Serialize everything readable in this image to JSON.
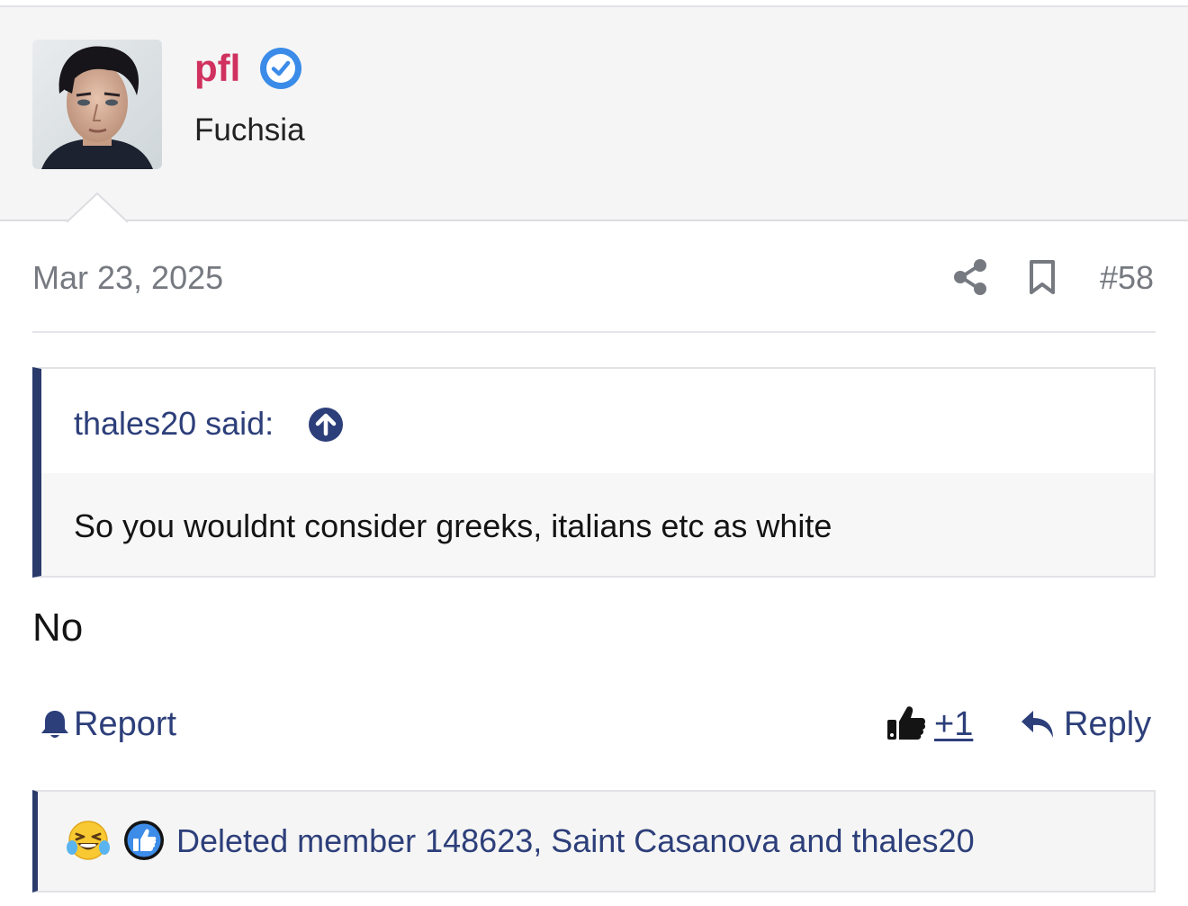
{
  "user": {
    "username": "pfl",
    "title": "Fuchsia",
    "avatar_icon": "avatar-portrait",
    "verified_icon": "verified-check-icon"
  },
  "post": {
    "date": "Mar 23, 2025",
    "number": "#58",
    "body": "No"
  },
  "quote": {
    "author_line": "thales20 said:",
    "text": "So you wouldnt consider greeks, italians etc as white"
  },
  "actions": {
    "report_label": "Report",
    "like_count": "+1",
    "reply_label": "Reply"
  },
  "reactions": {
    "names": "Deleted member 148623, Saint Casanova and thales20",
    "icons": [
      "laughing-tears-emoji",
      "thumbs-up-reaction"
    ]
  },
  "colors": {
    "username": "#d0315e",
    "link": "#2d3f7a",
    "quote_bar": "#2a3a6b",
    "verified": "#3b8be8"
  }
}
